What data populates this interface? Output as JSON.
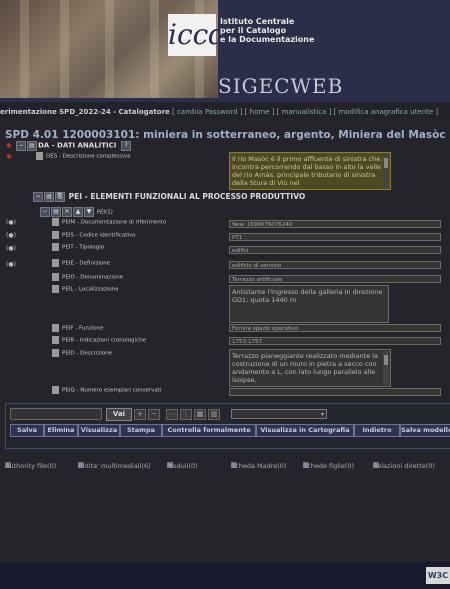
{
  "header": {
    "iccd_logo": "iccd",
    "institute_line1": "Istituto Centrale",
    "institute_line2": "per il Catalogo",
    "institute_line3": "e la Documentazione",
    "app_name": "SIGECWEB"
  },
  "nav": {
    "context": "erimentazione SPD_2022-24 - Catalogatore",
    "links": [
      "[ cambia Password ]",
      "[ home ]",
      "[ manualistica ]",
      "[ modifica anagrafica utente ]"
    ]
  },
  "record": {
    "title": "SPD 4.01 1200003101: miniera in sotterraneo, argento, Miniera del Masòc"
  },
  "tree": {
    "da_label": "DA - DATI ANALITICI",
    "da_help": "?",
    "des_label": "DES - Descrizione complessiva",
    "des_value": "Il rio Masòc è il primo affluente di sinistra che si incontra percorrendo dal basso in alto la valle del rio Arnàs, principale tributario di sinistra della Stura di Viù nel",
    "pei_label": "PEI - ELEMENTI FUNZIONALI AL PROCESSO PRODUTTIVO",
    "pei_sub": "PEI(1)",
    "fields": [
      {
        "label": "PEIM - Documentazione di riferimento",
        "value": "New_1699676076240"
      },
      {
        "label": "PEIS - Codice identificativo",
        "value": "PT1"
      },
      {
        "label": "PEIT - Tipologia",
        "value": "edifici"
      },
      {
        "label": "PEIE - Definizione",
        "value": "edificio di servizio"
      },
      {
        "label": "PEIO - Denominazione",
        "value": "Terrazzo artificiale"
      }
    ],
    "peil_label": "PEIL - Localizzazione",
    "peil_value": "Antistante l'ingresso della galleria in direzione GD1; quota 1440 m",
    "peif_label": "PEIF - Funzione",
    "peif_value": "Fornire spazio operativo",
    "peir_label": "PEIR - Indicazioni cronologiche",
    "peir_value": "1753-1757",
    "peid_label": "PEID - Descrizione",
    "peid_value": "Terrazzo pianeggiante realizzato mediante la costruzione di un muro in pietra a secco con andamento a L, con lato lungo parallelo alle isoipse,",
    "peiq_label": "PEIQ - Numero esemplari conservati",
    "peiq_value": ""
  },
  "toolbar": {
    "search_value": "",
    "vai_label": "Vai",
    "select_value": "",
    "buttons": [
      "Salva",
      "Elimina",
      "Visualizza",
      "Stampa",
      "Controlla formalmente",
      "Visualizza in Cartografia",
      "Indietro",
      "Salva modello"
    ]
  },
  "bottom_links": {
    "authority": "Authority file(0)",
    "multimedia": "Entita' multimediali(6)",
    "moduli": "Moduli(0)",
    "scheda_madre": "Scheda Madre(0)",
    "schede_figlie": "Schede figlie(0)",
    "relazioni": "Relazioni dirette(0)"
  },
  "footer": {
    "badge": "W3C"
  }
}
